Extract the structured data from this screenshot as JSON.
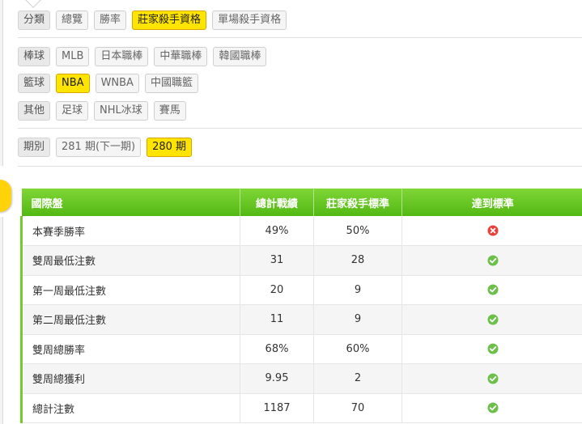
{
  "filters": {
    "category": {
      "label": "分類",
      "options": [
        {
          "label": "總覽",
          "active": false
        },
        {
          "label": "勝率",
          "active": false
        },
        {
          "label": "莊家殺手資格",
          "active": true
        },
        {
          "label": "單場殺手資格",
          "active": false
        }
      ]
    },
    "baseball": {
      "label": "棒球",
      "options": [
        {
          "label": "MLB",
          "active": false
        },
        {
          "label": "日本職棒",
          "active": false
        },
        {
          "label": "中華職棒",
          "active": false
        },
        {
          "label": "韓國職棒",
          "active": false
        }
      ]
    },
    "basketball": {
      "label": "籃球",
      "options": [
        {
          "label": "NBA",
          "active": true
        },
        {
          "label": "WNBA",
          "active": false
        },
        {
          "label": "中國職籃",
          "active": false
        }
      ]
    },
    "other": {
      "label": "其他",
      "options": [
        {
          "label": "足球",
          "active": false
        },
        {
          "label": "NHL冰球",
          "active": false
        },
        {
          "label": "賽馬",
          "active": false
        }
      ]
    },
    "period": {
      "label": "期別",
      "options": [
        {
          "label": "281 期(下一期)",
          "active": false
        },
        {
          "label": "280 期",
          "active": true
        }
      ]
    }
  },
  "colors": {
    "accent_yellow": "#ffe400",
    "header_green": "#5cbd1a",
    "pass_green": "#6cc04a",
    "fail_red": "#e8413a"
  },
  "table": {
    "headers": [
      "國際盤",
      "總計戰績",
      "莊家殺手標準",
      "達到標準"
    ],
    "rows": [
      {
        "item": "本賽季勝率",
        "record": "49%",
        "standard": "50%",
        "met": false,
        "icon": "fail-icon"
      },
      {
        "item": "雙周最低注數",
        "record": "31",
        "standard": "28",
        "met": true,
        "icon": "check-icon"
      },
      {
        "item": "第一周最低注數",
        "record": "20",
        "standard": "9",
        "met": true,
        "icon": "check-icon"
      },
      {
        "item": "第二周最低注數",
        "record": "11",
        "standard": "9",
        "met": true,
        "icon": "check-icon"
      },
      {
        "item": "雙周總勝率",
        "record": "68%",
        "standard": "60%",
        "met": true,
        "icon": "check-icon"
      },
      {
        "item": "雙周總獲利",
        "record": "9.95",
        "standard": "2",
        "met": true,
        "icon": "check-icon"
      },
      {
        "item": "總計注數",
        "record": "1187",
        "standard": "70",
        "met": true,
        "icon": "check-icon"
      }
    ]
  }
}
